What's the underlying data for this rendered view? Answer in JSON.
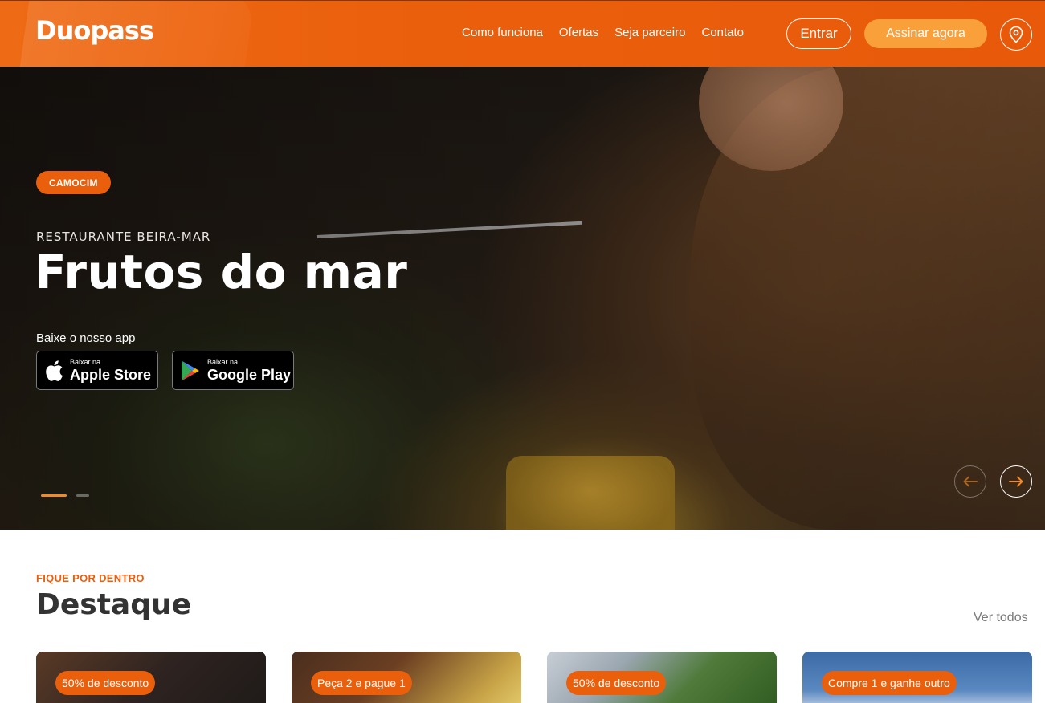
{
  "brand": {
    "name": "Duopass",
    "accent": "#ea5f0c",
    "accent_light": "#f9a03a"
  },
  "header": {
    "nav": [
      "Como funciona",
      "Ofertas",
      "Seja parceiro",
      "Contato"
    ],
    "login_label": "Entrar",
    "subscribe_label": "Assinar agora",
    "location_icon": "map-pin-icon"
  },
  "hero": {
    "city_tag": "CAMOCIM",
    "kicker": "RESTAURANTE BEIRA-MAR",
    "title": "Frutos do mar",
    "app_label": "Baixe o nosso app",
    "apple": {
      "small": "Baixar na",
      "big": "Apple Store",
      "icon": "apple-icon"
    },
    "google": {
      "small": "Baixar na",
      "big": "Google Play",
      "icon": "google-play-icon"
    },
    "slides": {
      "count": 2,
      "active": 1
    }
  },
  "highlights": {
    "kicker": "FIQUE POR DENTRO",
    "title": "Destaque",
    "see_all": "Ver todos",
    "cards": [
      {
        "badge": "50% de desconto"
      },
      {
        "badge": "Peça 2 e pague 1"
      },
      {
        "badge": "50% de desconto"
      },
      {
        "badge": "Compre 1 e ganhe outro"
      }
    ]
  }
}
